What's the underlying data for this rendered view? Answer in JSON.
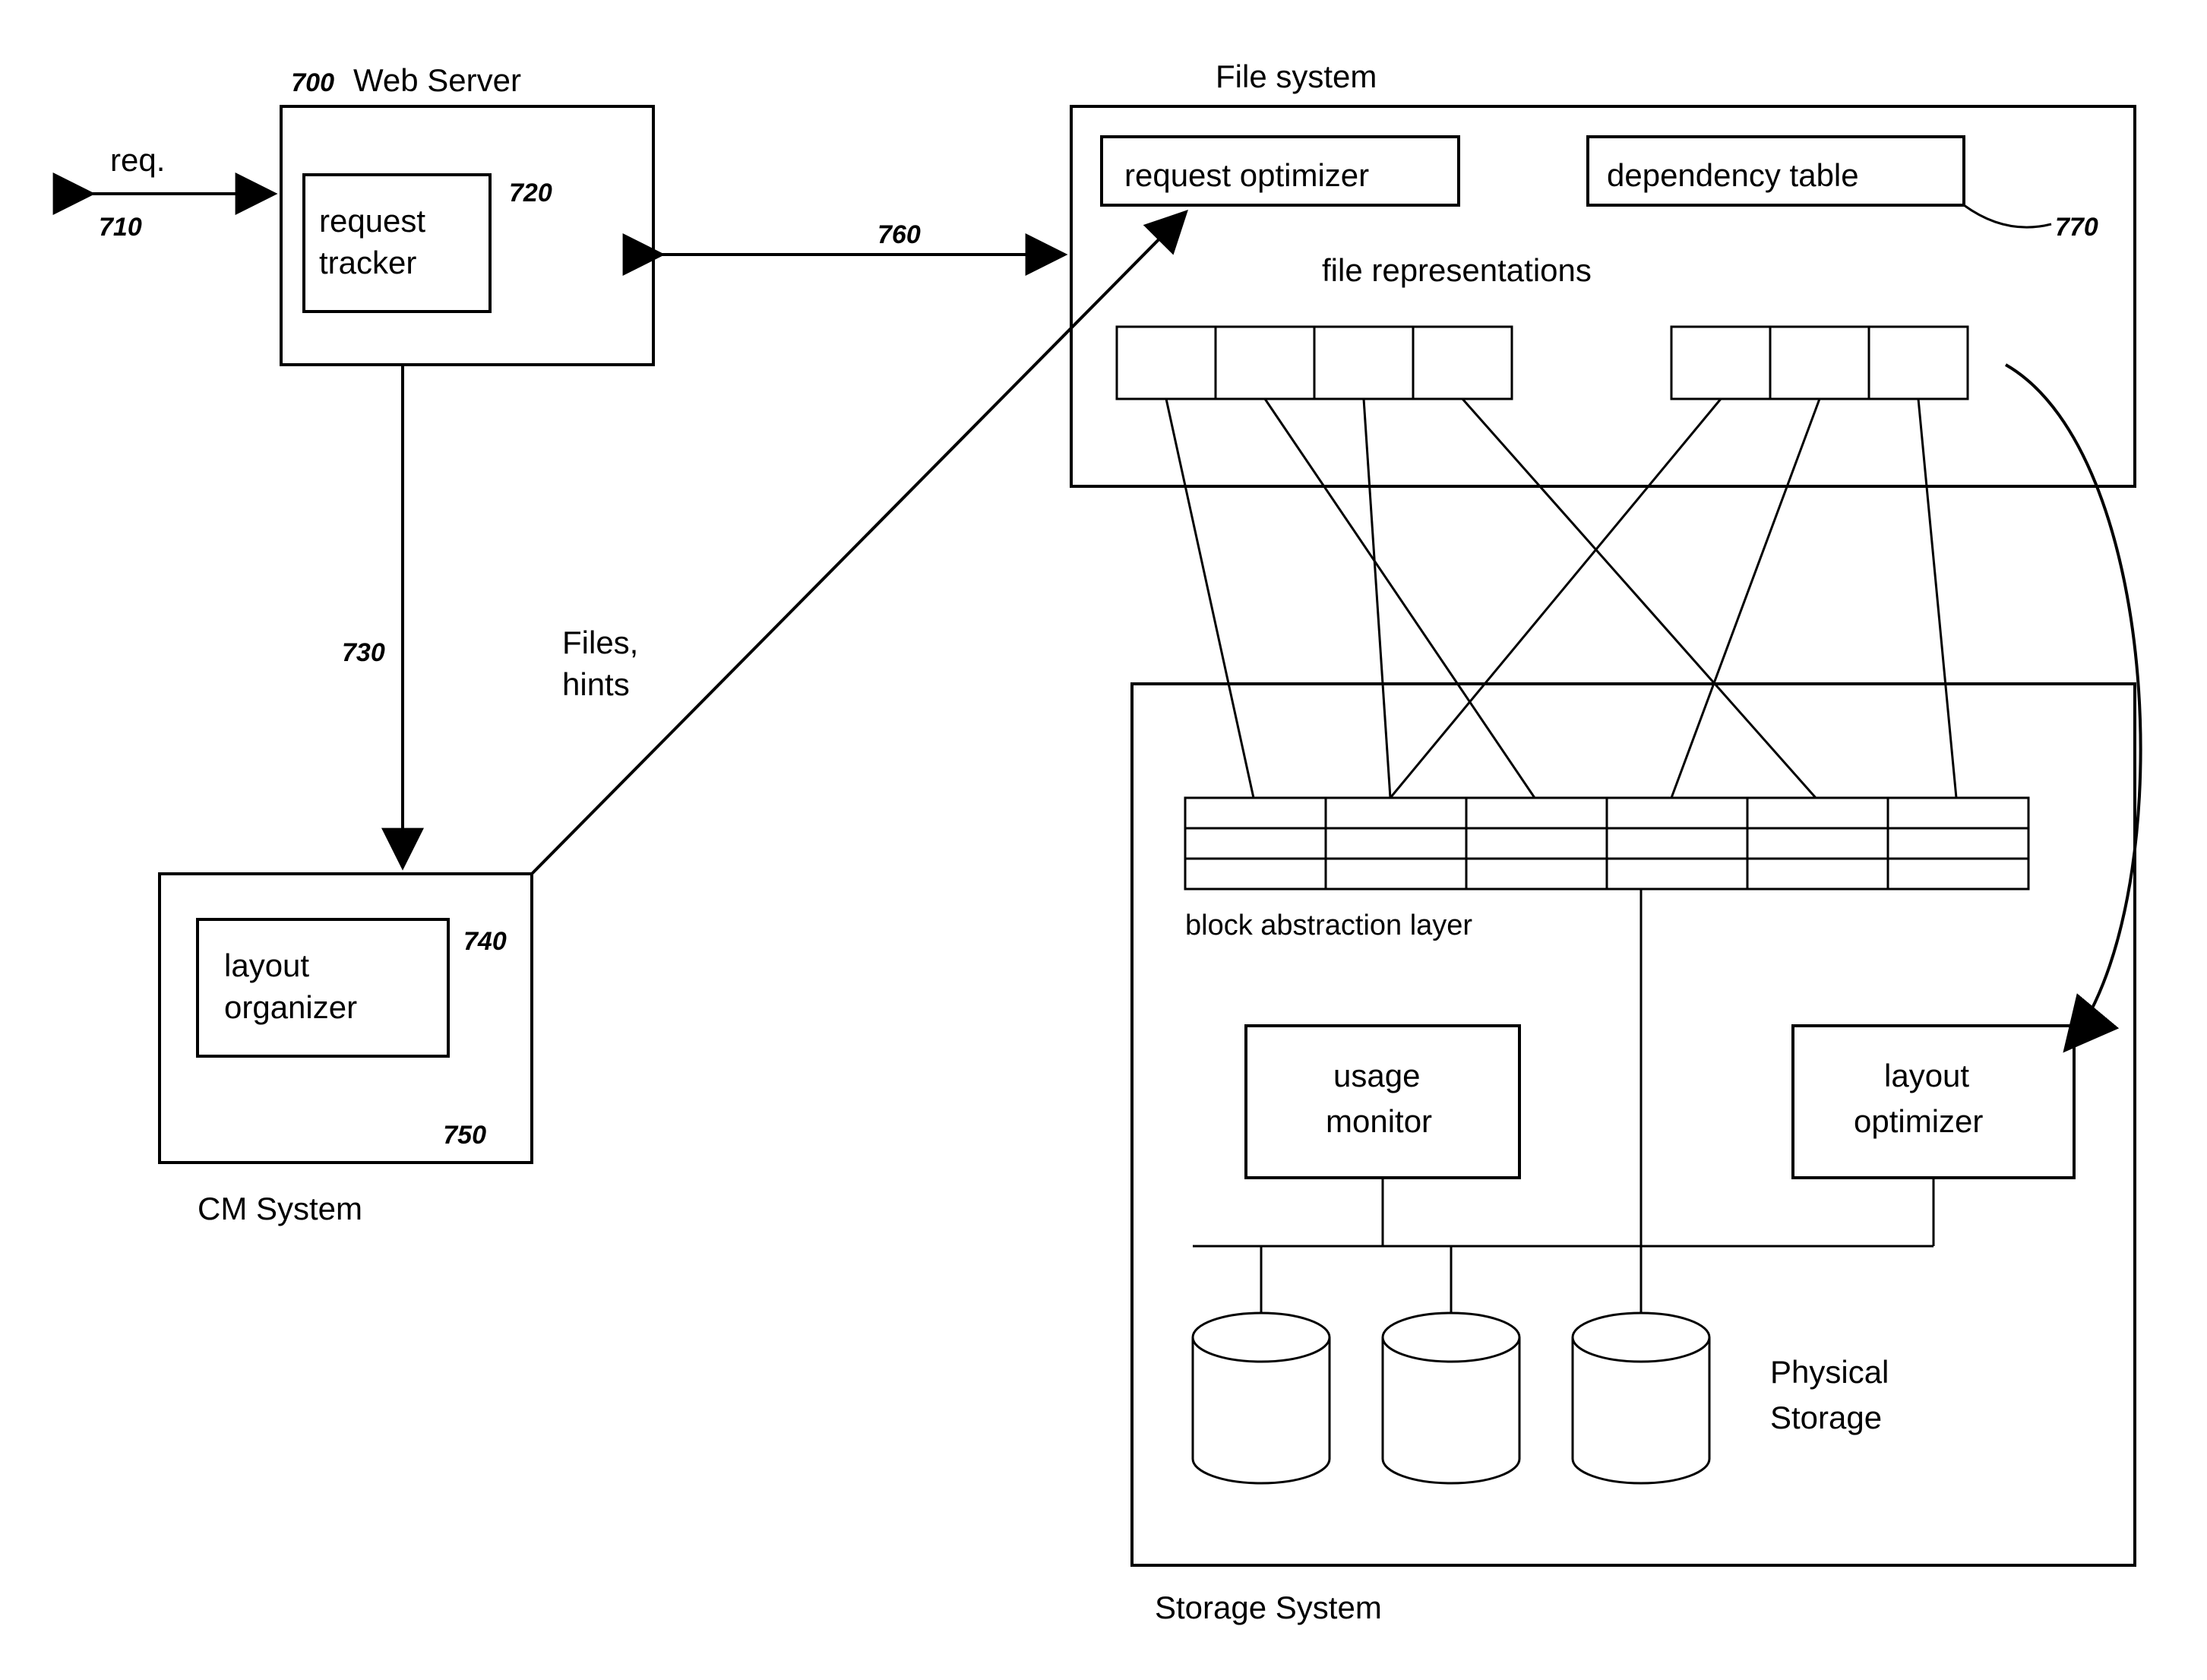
{
  "diagram": {
    "web_server": {
      "title": "Web Server",
      "ref": "700",
      "request_tracker": "request\ntracker",
      "request_tracker_ref": "720",
      "req_label": "req.",
      "req_ref": "710"
    },
    "cm_system": {
      "title": "CM System",
      "layout_organizer": "layout\norganizer",
      "layout_organizer_ref": "740",
      "box_ref": "750",
      "arrow_from_ws_ref": "730"
    },
    "file_system": {
      "title": "File system",
      "request_optimizer": "request optimizer",
      "dependency_table": "dependency table",
      "dependency_table_ref": "770",
      "file_representations": "file representations",
      "arrow_from_ws_ref": "760"
    },
    "storage_system": {
      "title": "Storage System",
      "block_abstraction_layer": "block abstraction layer",
      "usage_monitor": "usage\nmonitor",
      "layout_optimizer": "layout\noptimizer",
      "physical_storage": "Physical\nStorage"
    },
    "files_hints": "Files,\nhints"
  }
}
